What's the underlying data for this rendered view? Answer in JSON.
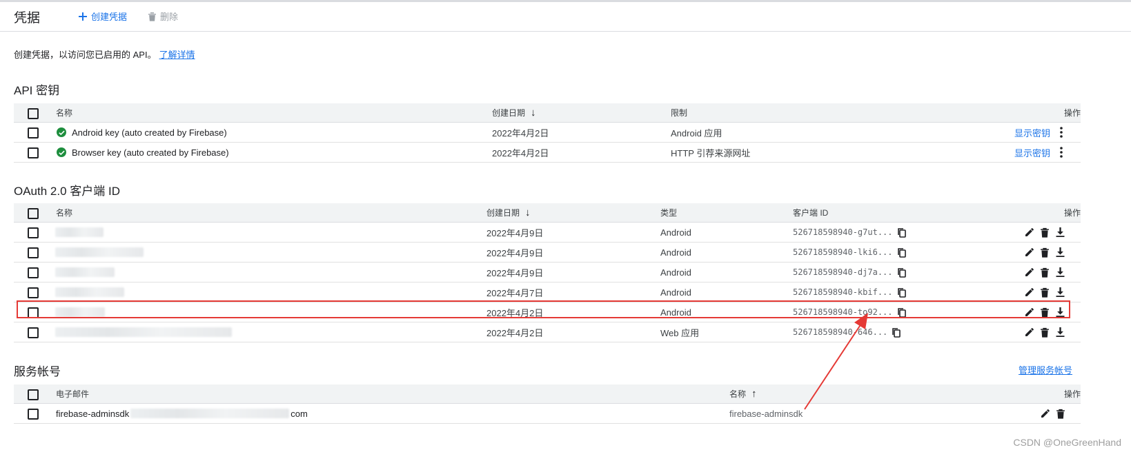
{
  "header": {
    "title": "凭据",
    "create_label": "创建凭据",
    "delete_label": "删除"
  },
  "intro": {
    "text": "创建凭据，以访问您已启用的 API。",
    "link": "了解详情"
  },
  "api_keys": {
    "title": "API 密钥",
    "columns": {
      "name": "名称",
      "created": "创建日期",
      "restriction": "限制",
      "actions": "操作"
    },
    "rows": [
      {
        "name": "Android key (auto created by Firebase)",
        "created": "2022年4月2日",
        "restriction": "Android 应用",
        "action": "显示密钥"
      },
      {
        "name": "Browser key (auto created by Firebase)",
        "created": "2022年4月2日",
        "restriction": "HTTP 引荐来源网址",
        "action": "显示密钥"
      }
    ]
  },
  "oauth": {
    "title": "OAuth 2.0 客户端 ID",
    "columns": {
      "name": "名称",
      "created": "创建日期",
      "type": "类型",
      "client_id": "客户端 ID",
      "actions": "操作"
    },
    "rows": [
      {
        "created": "2022年4月9日",
        "type": "Android",
        "client_id": "526718598940-g7ut..."
      },
      {
        "created": "2022年4月9日",
        "type": "Android",
        "client_id": "526718598940-lki6..."
      },
      {
        "created": "2022年4月9日",
        "type": "Android",
        "client_id": "526718598940-dj7a..."
      },
      {
        "created": "2022年4月7日",
        "type": "Android",
        "client_id": "526718598940-kbif..."
      },
      {
        "created": "2022年4月2日",
        "type": "Android",
        "client_id": "526718598940-to92..."
      },
      {
        "created": "2022年4月2日",
        "type": "Web 应用",
        "client_id": "526718598940-646..."
      }
    ]
  },
  "service_accounts": {
    "title": "服务帐号",
    "manage_link": "管理服务帐号",
    "columns": {
      "email": "电子邮件",
      "name": "名称",
      "actions": "操作"
    },
    "rows": [
      {
        "email_prefix": "firebase-adminsdk",
        "email_suffix": "com",
        "name": "firebase-adminsdk"
      }
    ]
  },
  "watermark": "CSDN @OneGreenHand",
  "colors": {
    "accent": "#1a73e8",
    "success": "#1e8e3e",
    "highlight": "#e53935"
  }
}
